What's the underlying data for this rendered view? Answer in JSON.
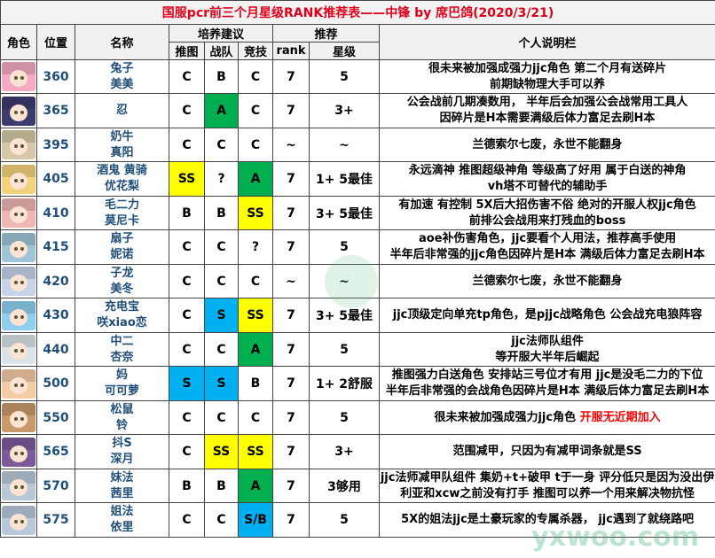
{
  "title": "国服pcr前三个月星级RANK推荐表——中锋  by  席巴鸽(2020/3/21)",
  "headers": {
    "role": "角色",
    "position": "位置",
    "name": "名称",
    "training": "培养建议",
    "push": "推图",
    "clan": "战队",
    "arena": "竞技",
    "recommend": "推荐",
    "rank": "rank",
    "star": "星级",
    "note": "个人说明栏"
  },
  "rows": [
    {
      "pos": "360",
      "name1": "兔子",
      "name2": "美美",
      "push": "C",
      "clan": "B",
      "arena": "C",
      "rank": "7",
      "star": "5",
      "note1": "很未来被加强成强力jjc角色 第二个月有送碎片",
      "note2": "前期缺物理大手可以养",
      "note_red": ""
    },
    {
      "pos": "365",
      "name1": "忍",
      "name2": "",
      "push": "C",
      "clan": "A",
      "arena": "C",
      "rank": "7",
      "star": "3+",
      "note1": "公会战前几期凑数用，  半年后会加强公会战常用工具人",
      "note2": "因碎片是H本需要满级后体力富足去刷H本",
      "note_red": ""
    },
    {
      "pos": "395",
      "name1": "奶牛",
      "name2": "真阳",
      "push": "C",
      "clan": "C",
      "arena": "C",
      "rank": "~",
      "star": "~",
      "note1": "兰德索尔七废，永世不能翻身",
      "note2": "",
      "note_red": ""
    },
    {
      "pos": "405",
      "name1": "酒鬼 黄骑",
      "name2": "优花梨",
      "push": "SS",
      "clan": "?",
      "arena": "A",
      "rank": "7",
      "star": "1+ 5最佳",
      "note1": "永远滴神 推图超级神角 等级高了好用 属于白送的神角",
      "note2": "vh塔不可替代的辅助手",
      "note_red": ""
    },
    {
      "pos": "410",
      "name1": "毛二力",
      "name2": "莫尼卡",
      "push": "B",
      "clan": "B",
      "arena": "SS",
      "rank": "7",
      "star": "3+ 5最佳",
      "note1": "有加速 有控制 5X后大招伤害不俗 绝对的开服人权jjc角色",
      "note2": "前排公会战用来打残血的boss",
      "note_red": ""
    },
    {
      "pos": "415",
      "name1": "扇子",
      "name2": "妮诺",
      "push": "C",
      "clan": "C",
      "arena": "?",
      "rank": "7",
      "star": "5",
      "note1": "aoe补伤害角色，jjc要看个人用法，推荐高手使用",
      "note2": "半年后非常强的jjc角色因碎片是H本 满级后体力富足去刷H本",
      "note_red": ""
    },
    {
      "pos": "420",
      "name1": "子龙",
      "name2": "美冬",
      "push": "C",
      "clan": "C",
      "arena": "C",
      "rank": "~",
      "star": "~",
      "note1": "兰德索尔七废，永世不能翻身",
      "note2": "",
      "note_red": ""
    },
    {
      "pos": "430",
      "name1": "充电宝",
      "name2": "咲xiao恋",
      "push": "C",
      "clan": "S",
      "arena": "SS",
      "rank": "7",
      "star": "3+ 5最佳",
      "note1": "jjc顶级定向单充tp角色，是pjjc战略角色  公会战充电狼阵容",
      "note2": "",
      "note_red": ""
    },
    {
      "pos": "440",
      "name1": "中二",
      "name2": "杏奈",
      "push": "C",
      "clan": "C",
      "arena": "A",
      "rank": "7",
      "star": "5",
      "note1": "jjc法师队组件",
      "note2": "等开服大半年后崛起",
      "note_red": ""
    },
    {
      "pos": "500",
      "name1": "妈",
      "name2": "可可萝",
      "push": "S",
      "clan": "S",
      "arena": "B",
      "rank": "7",
      "star": "1+ 2舒服",
      "note1": "推图强力白送角色  安排站三号位才有用  jjc是没毛二力的下位",
      "note2": "半年后非常强的会战角色因碎片是H本 满级后体力富足去刷H本",
      "note_red": ""
    },
    {
      "pos": "550",
      "name1": "松鼠",
      "name2": "铃",
      "push": "C",
      "clan": "C",
      "arena": "C",
      "rank": "7",
      "star": "5",
      "note1": "很未来被加强成强力jjc角色",
      "note2": "",
      "note_red": "开服无近期加入"
    },
    {
      "pos": "565",
      "name1": "抖S",
      "name2": "深月",
      "push": "C",
      "clan": "SS",
      "arena": "SS",
      "rank": "7",
      "star": "3+",
      "note1": "范围减甲，只因为有减甲词条就是SS",
      "note2": "",
      "note_red": ""
    },
    {
      "pos": "570",
      "name1": "妹法",
      "name2": "茜里",
      "push": "B",
      "clan": "B",
      "arena": "A",
      "rank": "7",
      "star": "3够用",
      "note1": "jjc法师减甲队组件 集奶+t+破甲 t于一身  评分低只是因为没出伊",
      "note2": "利亚和xcw之前没有打手   推图可以养一个用来解决物抗怪",
      "note_red": ""
    },
    {
      "pos": "575",
      "name1": "姐法",
      "name2": "依里",
      "push": "C",
      "clan": "C",
      "arena": "S/B",
      "rank": "7",
      "star": "5",
      "note1": "5X的姐法jjc是土豪玩家的专属杀器，  jjc遇到了就绕路吧",
      "note2": "",
      "note_red": ""
    }
  ],
  "grade_colors": {
    "SS": "#ffff00",
    "A": "#00b050",
    "S": "#00b0f0",
    "S/B": "#00b0f0"
  },
  "avatar_colors": [
    "#f6a9c2",
    "#3c3b6e",
    "#d4c8a6",
    "#f2d27a",
    "#f0b5b5",
    "#9ec4d8",
    "#c6d3ea",
    "#8ecff0",
    "#dbe3e8",
    "#f3cba5",
    "#c89a6a",
    "#7c5a9a",
    "#b7c9d6",
    "#b9c9dd"
  ],
  "watermark": "yxwoo.com"
}
